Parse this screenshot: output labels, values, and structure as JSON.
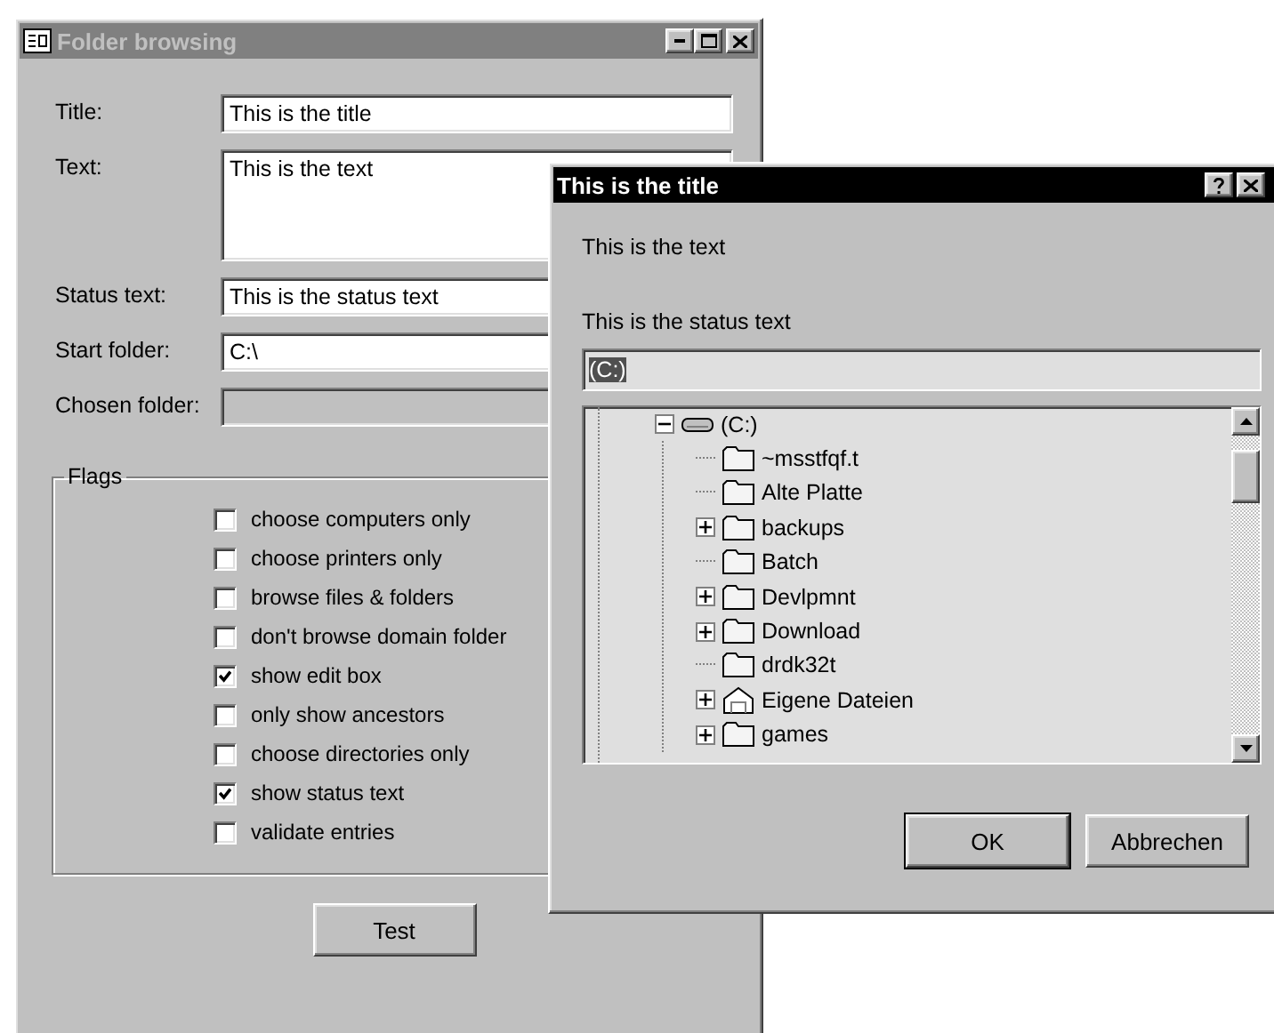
{
  "main_window": {
    "title": "Folder browsing",
    "active": false,
    "fields": [
      {
        "label": "Title:",
        "kind": "line",
        "value": "This is the title"
      },
      {
        "label": "Text:",
        "kind": "multiline",
        "value": "This is the text"
      },
      {
        "label": "Status text:",
        "kind": "line",
        "value": "This is the status text"
      },
      {
        "label": "Start folder:",
        "kind": "line",
        "value": "C:\\"
      },
      {
        "label": "Chosen folder:",
        "kind": "readonly"
      }
    ],
    "flags": {
      "title": "Flags",
      "items": [
        {
          "label": "choose computers only",
          "checked": false
        },
        {
          "label": "choose printers only",
          "checked": false
        },
        {
          "label": "browse files & folders",
          "checked": false
        },
        {
          "label": "don't browse domain folder",
          "checked": false
        },
        {
          "label": "show edit box",
          "checked": true
        },
        {
          "label": "only show ancestors",
          "checked": false
        },
        {
          "label": "choose directories only",
          "checked": false
        },
        {
          "label": "show status text",
          "checked": true
        },
        {
          "label": "validate entries",
          "checked": false
        }
      ]
    },
    "button": "Test"
  },
  "dialog": {
    "title": "This is the title",
    "active": true,
    "text": "This is the text",
    "status_text": "This is the status text",
    "edit_box": {
      "value": "(C:)",
      "highlighted": true
    },
    "tree": [
      {
        "label": "(C:)",
        "kind": "drive",
        "expanded": true,
        "children": [
          {
            "label": "~msstfqf.t",
            "kind": "folder"
          },
          {
            "label": "Alte Platte",
            "kind": "folder"
          },
          {
            "label": "backups",
            "kind": "folder",
            "expanded": false
          },
          {
            "label": "Batch",
            "kind": "folder"
          },
          {
            "label": "Devlpmnt",
            "kind": "folder",
            "expanded": false
          },
          {
            "label": "Download",
            "kind": "folder",
            "expanded": false
          },
          {
            "label": "drdk32t",
            "kind": "folder"
          },
          {
            "label": "Eigene Dateien",
            "kind": "home",
            "expanded": false
          },
          {
            "label": "games",
            "kind": "folder",
            "expanded": false
          }
        ]
      }
    ],
    "buttons": [
      {
        "label": "OK",
        "default": true
      },
      {
        "label": "Abbrechen",
        "default": false
      }
    ]
  }
}
